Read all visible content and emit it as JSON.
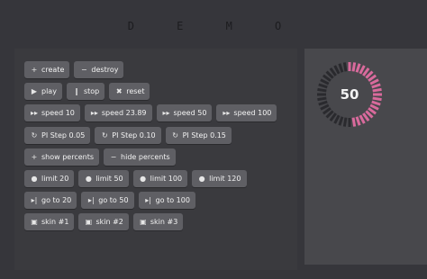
{
  "title": "D E M O",
  "rows": [
    [
      {
        "name": "create-button",
        "icon": "+",
        "label": "create"
      },
      {
        "name": "destroy-button",
        "icon": "−",
        "label": "destroy"
      }
    ],
    [
      {
        "name": "play-button",
        "icon": "▶",
        "label": "play"
      },
      {
        "name": "stop-button",
        "icon": "‖",
        "label": "stop"
      },
      {
        "name": "reset-button",
        "icon": "✖",
        "label": "reset"
      }
    ],
    [
      {
        "name": "speed-10-button",
        "icon": "▸▸",
        "label": "speed 10"
      },
      {
        "name": "speed-23-89-button",
        "icon": "▸▸",
        "label": "speed 23.89"
      },
      {
        "name": "speed-50-button",
        "icon": "▸▸",
        "label": "speed 50"
      },
      {
        "name": "speed-100-button",
        "icon": "▸▸",
        "label": "speed 100"
      }
    ],
    [
      {
        "name": "pi-step-0-05-button",
        "icon": "↻",
        "label": "PI Step 0.05"
      },
      {
        "name": "pi-step-0-10-button",
        "icon": "↻",
        "label": "PI Step 0.10"
      },
      {
        "name": "pi-step-0-15-button",
        "icon": "↻",
        "label": "PI Step 0.15"
      }
    ],
    [
      {
        "name": "show-percents-button",
        "icon": "+",
        "label": "show percents"
      },
      {
        "name": "hide-percents-button",
        "icon": "−",
        "label": "hide percents"
      }
    ],
    [
      {
        "name": "limit-20-button",
        "icon": "●",
        "label": "limit 20"
      },
      {
        "name": "limit-50-button",
        "icon": "●",
        "label": "limit 50"
      },
      {
        "name": "limit-100-button",
        "icon": "●",
        "label": "limit 100"
      },
      {
        "name": "limit-120-button",
        "icon": "●",
        "label": "limit 120"
      }
    ],
    [
      {
        "name": "go-to-20-button",
        "icon": "▸|",
        "label": "go to 20"
      },
      {
        "name": "go-to-50-button",
        "icon": "▸|",
        "label": "go to 50"
      },
      {
        "name": "go-to-100-button",
        "icon": "▸|",
        "label": "go to 100"
      }
    ],
    [
      {
        "name": "skin-1-button",
        "icon": "▣",
        "label": "skin #1"
      },
      {
        "name": "skin-2-button",
        "icon": "▣",
        "label": "skin #2"
      },
      {
        "name": "skin-3-button",
        "icon": "▣",
        "label": "skin #3"
      }
    ]
  ],
  "gauge": {
    "value": "50",
    "progress": 0.5,
    "segments": 40,
    "active_color": "#d96a9c",
    "inactive_color": "#2a2a2e"
  }
}
